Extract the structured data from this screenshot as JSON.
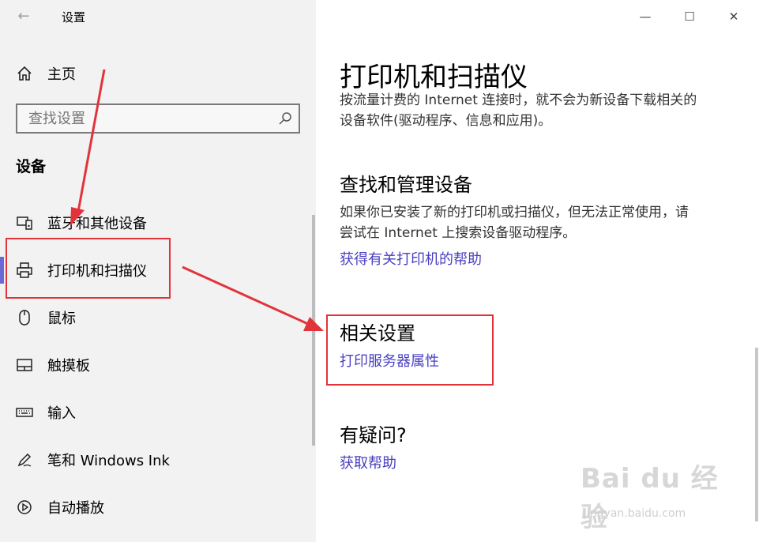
{
  "window": {
    "title": "设置",
    "controls": {
      "minimize": "—",
      "maximize": "☐",
      "close": "✕"
    }
  },
  "sidebar": {
    "home_label": "主页",
    "search_placeholder": "查找设置",
    "section_title": "设备",
    "items": [
      {
        "label": "蓝牙和其他设备",
        "icon": "bluetooth-devices-icon"
      },
      {
        "label": "打印机和扫描仪",
        "icon": "printer-icon",
        "active": true
      },
      {
        "label": "鼠标",
        "icon": "mouse-icon"
      },
      {
        "label": "触摸板",
        "icon": "touchpad-icon"
      },
      {
        "label": "输入",
        "icon": "keyboard-icon"
      },
      {
        "label": "笔和 Windows Ink",
        "icon": "pen-icon"
      },
      {
        "label": "自动播放",
        "icon": "autoplay-icon"
      }
    ]
  },
  "content": {
    "title": "打印机和扫描仪",
    "metered_text_line1": "按流量计费的 Internet 连接时，就不会为新设备下载相关的",
    "metered_text_line2": "设备软件(驱动程序、信息和应用)。",
    "find_manage_title": "查找和管理设备",
    "find_manage_line1": "如果你已安装了新的打印机或扫描仪，但无法正常使用，请",
    "find_manage_line2": "尝试在 Internet 上搜索设备驱动程序。",
    "printer_help_link": "获得有关打印机的帮助",
    "related_title": "相关设置",
    "print_server_link": "打印服务器属性",
    "question_title": "有疑问?",
    "get_help_link": "获取帮助"
  },
  "watermark": {
    "logo": "Bai du 经验",
    "url": "jingyan.baidu.com"
  },
  "colors": {
    "accent": "#6b69d6",
    "link": "#4a3fc2",
    "annotation": "#e2333b",
    "sidebar_bg": "#f2f2f2"
  }
}
